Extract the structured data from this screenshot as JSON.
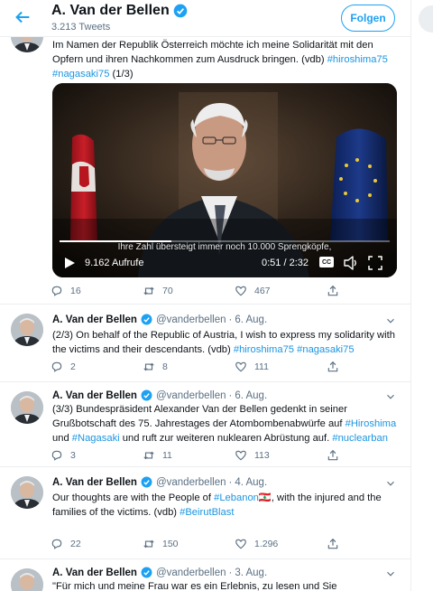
{
  "header": {
    "name": "A. Van der Bellen",
    "tweet_count": "3.213 Tweets",
    "follow_label": "Folgen"
  },
  "tweets": [
    {
      "text_parts": [
        {
          "t": "Im Namen der Republik Österreich möchte ich meine Solidarität mit den Opfern und ihren Nachkommen zum Ausdruck bringen. (vdb) ",
          "link": false
        },
        {
          "t": "#hiroshima75",
          "link": true
        },
        {
          "t": " ",
          "link": false
        },
        {
          "t": "#nagasaki75",
          "link": true
        },
        {
          "t": " (1/3)",
          "link": false
        }
      ],
      "video": {
        "subtitle": "Ihre Zahl übersteigt immer noch 10.000 Sprengköpfe,",
        "views": "9.162 Aufrufe",
        "time": "0:51 / 2:32",
        "cc_label": "CC",
        "progress_fraction": 0.34
      },
      "replies": "16",
      "retweets": "70",
      "likes": "467"
    },
    {
      "name": "A. Van der Bellen",
      "handle": "@vanderbellen",
      "date": "6. Aug.",
      "text_parts": [
        {
          "t": "(2/3) On behalf of the Republic of Austria, I wish to express my solidarity with the victims and their descendants. (vdb) ",
          "link": false
        },
        {
          "t": "#hiroshima75",
          "link": true
        },
        {
          "t": " ",
          "link": false
        },
        {
          "t": "#nagasaki75",
          "link": true
        }
      ],
      "replies": "2",
      "retweets": "8",
      "likes": "111"
    },
    {
      "name": "A. Van der Bellen",
      "handle": "@vanderbellen",
      "date": "6. Aug.",
      "text_parts": [
        {
          "t": "(3/3) Bundespräsident Alexander Van der Bellen gedenkt in seiner Grußbotschaft des 75. Jahrestages der Atombombenabwürfe auf ",
          "link": false
        },
        {
          "t": "#Hiroshima",
          "link": true
        },
        {
          "t": " und ",
          "link": false
        },
        {
          "t": "#Nagasaki",
          "link": true
        },
        {
          "t": " und ruft zur weiteren nuklearen Abrüstung auf. ",
          "link": false
        },
        {
          "t": "#nuclearban",
          "link": true
        }
      ],
      "replies": "3",
      "retweets": "11",
      "likes": "113"
    },
    {
      "name": "A. Van der Bellen",
      "handle": "@vanderbellen",
      "date": "4. Aug.",
      "text_parts": [
        {
          "t": "Our thoughts are with the People of ",
          "link": false
        },
        {
          "t": "#Lebanon",
          "link": true
        },
        {
          "t": "🇱🇧",
          "link": false,
          "emoji": true
        },
        {
          "t": ", with the injured and the families of the victims. (vdb) ",
          "link": false
        },
        {
          "t": "#BeirutBlast",
          "link": true
        }
      ],
      "replies": "22",
      "retweets": "150",
      "likes": "1.296"
    },
    {
      "name": "A. Van der Bellen",
      "handle": "@vanderbellen",
      "date": "3. Aug.",
      "text_parts": [
        {
          "t": "\"Für mich und meine Frau war es ein Erlebnis, zu lesen und Sie",
          "link": false
        }
      ]
    }
  ],
  "colors": {
    "link": "#1b95e0",
    "accent": "#1da1f2",
    "muted": "#5b7083",
    "border": "#ebeef0"
  },
  "icons": [
    "back-arrow-icon",
    "verified-badge-icon",
    "caret-down-icon",
    "reply-icon",
    "retweet-icon",
    "like-icon",
    "share-icon",
    "play-icon",
    "volume-icon",
    "fullscreen-icon"
  ]
}
